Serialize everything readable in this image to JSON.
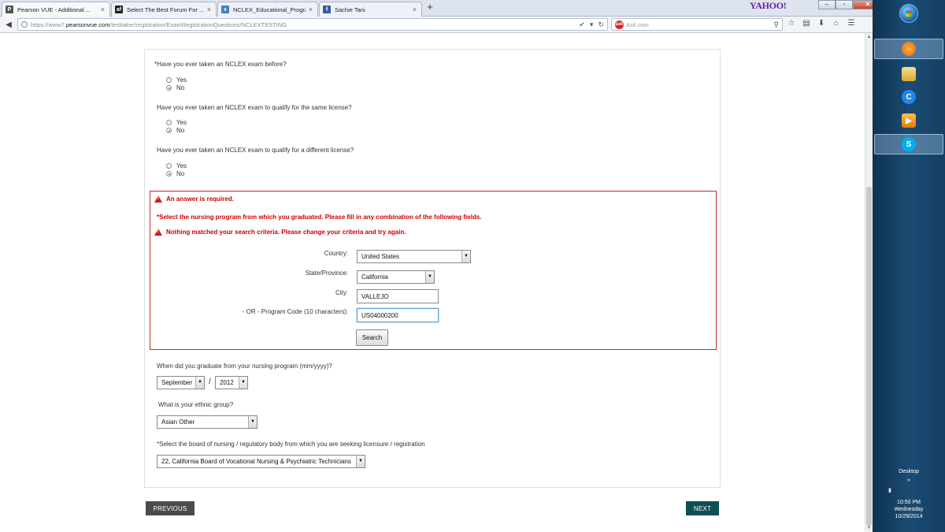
{
  "browser": {
    "tabs": [
      {
        "label": "Pearson VUE - Additional ...",
        "favicon": "P",
        "favicon_color": "#555555"
      },
      {
        "label": "Select The Best Forum For ...",
        "favicon": "af",
        "favicon_color": "#222222"
      },
      {
        "label": "NCLEX_Educational_Progra...",
        "favicon": "x",
        "favicon_color": "#3f7fc8"
      },
      {
        "label": "Sachie Tani",
        "favicon": "f",
        "favicon_color": "#3b5998"
      }
    ],
    "new_tab": "+",
    "brand": "YAHOO!",
    "url_prefix": "https://www7.",
    "url_domain": "pearsonvue.com",
    "url_path": "/testtaker/registration/ExamRegistrationQuestions/NCLEXTESTING",
    "search_placeholder": "Ask.com",
    "search_engine_badge": "ask"
  },
  "form": {
    "q1": {
      "text": "*Have you ever taken an NCLEX exam before?",
      "options": [
        "Yes",
        "No"
      ],
      "selected": "No"
    },
    "q2": {
      "text": "Have you ever taken an NCLEX exam to qualify for the same license?",
      "options": [
        "Yes",
        "No"
      ],
      "selected": "No"
    },
    "q3": {
      "text": "Have you ever taken an NCLEX exam to qualify for a different license?",
      "options": [
        "Yes",
        "No"
      ],
      "selected": "No"
    },
    "errors": {
      "required": "An answer is required.",
      "instruction": "*Select the nursing program from which you graduated. Please fill in any combination of the following fields.",
      "nomatch": "Nothing matched your search criteria. Please change your criteria and try again."
    },
    "country": {
      "label": "Country:",
      "value": "United States"
    },
    "state": {
      "label": "State/Province:",
      "value": "California"
    },
    "city": {
      "label": "City:",
      "value": "VALLEJO"
    },
    "program_code": {
      "label": "- OR - Program Code (10 characters):",
      "value": "US04000200"
    },
    "search_button": "Search",
    "graduation": {
      "text": "When did you graduate from your nursing program (mm/yyyy)?",
      "month": "September",
      "separator": "/",
      "year": "2012"
    },
    "ethnic": {
      "text": "What is your ethnic group?",
      "value": "Asian Other"
    },
    "board": {
      "text": "*Select the board of nursing / regulatory body from which you are seeking licensure / registration",
      "value": "22, California Board of Vocational Nursing & Psychiatric Technicians"
    }
  },
  "nav": {
    "previous": "PREVIOUS",
    "next": "NEXT"
  },
  "taskbar": {
    "desktop_label": "Desktop",
    "chevron": "»",
    "time": "10:50 PM",
    "day": "Wednesday",
    "date": "10/29/2014",
    "apps": [
      {
        "name": "firefox",
        "color": "#e66000"
      },
      {
        "name": "file-explorer",
        "color": "#e8c44a"
      },
      {
        "name": "ccleaner",
        "color": "#1e88e5"
      },
      {
        "name": "media-player",
        "color": "#f08a00"
      },
      {
        "name": "skype",
        "color": "#00aff0"
      }
    ]
  }
}
